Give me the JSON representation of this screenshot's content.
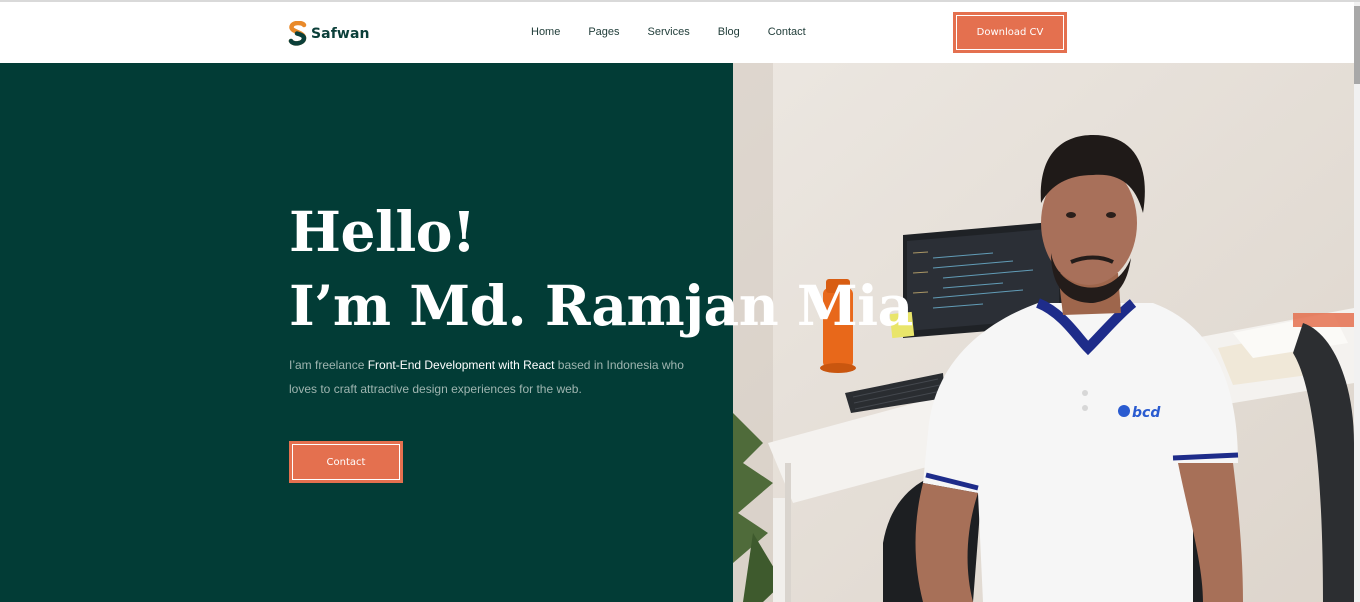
{
  "header": {
    "brand": "Safwan",
    "nav": [
      "Home",
      "Pages",
      "Services",
      "Blog",
      "Contact"
    ],
    "cta_label": "Download CV"
  },
  "hero": {
    "greeting": "Hello!",
    "name_line": "I’m Md. Ramjan Mia",
    "desc_prefix": "I’am freelance ",
    "desc_highlight": "Front-End Development with React",
    "desc_suffix": " based in Indonesia who loves to craft attractive design experiences for the web.",
    "cta_label": "Contact"
  },
  "photo": {
    "shirt_logo_text": "bcd"
  },
  "colors": {
    "brand_dark": "#023c36",
    "accent": "#e4704f",
    "white": "#ffffff"
  }
}
